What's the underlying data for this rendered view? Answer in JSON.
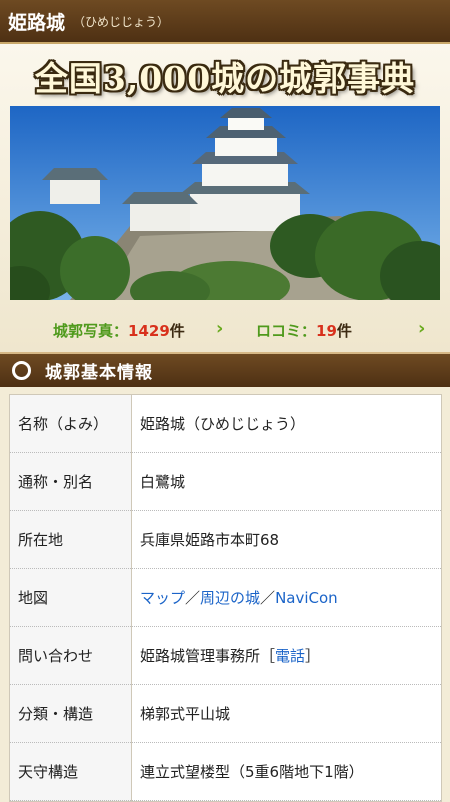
{
  "header": {
    "castle_name": "姫路城",
    "reading": "（ひめじじょう）"
  },
  "banner": {
    "title": "全国3,000城の城郭事典"
  },
  "photo": {
    "alt": "Himeji Castle photo"
  },
  "stats": {
    "photos_label": "城郭写真",
    "photos_sep": "：",
    "photos_count": "1429",
    "photos_unit": "件",
    "reviews_label": "ロコミ",
    "reviews_sep": "：",
    "reviews_count": "19",
    "reviews_unit": "件",
    "chevron": "›"
  },
  "section": {
    "title": "城郭基本情報"
  },
  "info_rows": [
    {
      "key": "名称（よみ）",
      "value": "姫路城（ひめじじょう）"
    },
    {
      "key": "通称・別名",
      "value": "白鷺城"
    },
    {
      "key": "所在地",
      "value": "兵庫県姫路市本町68"
    },
    {
      "key": "地図",
      "links": [
        "マップ",
        "周辺の城",
        "NaviCon"
      ],
      "sep": "／"
    },
    {
      "key": "問い合わせ",
      "value_prefix": "姫路城管理事務所［",
      "link": "電話",
      "value_suffix": "］"
    },
    {
      "key": "分類・構造",
      "value": "梯郭式平山城"
    },
    {
      "key": "天守構造",
      "value": "連立式望楼型（5重6階地下1階）"
    }
  ],
  "colors": {
    "header_brown": "#5a3a18",
    "accent_green": "#4f9a1c",
    "count_red": "#d8311c",
    "link_blue": "#1b64c8"
  }
}
